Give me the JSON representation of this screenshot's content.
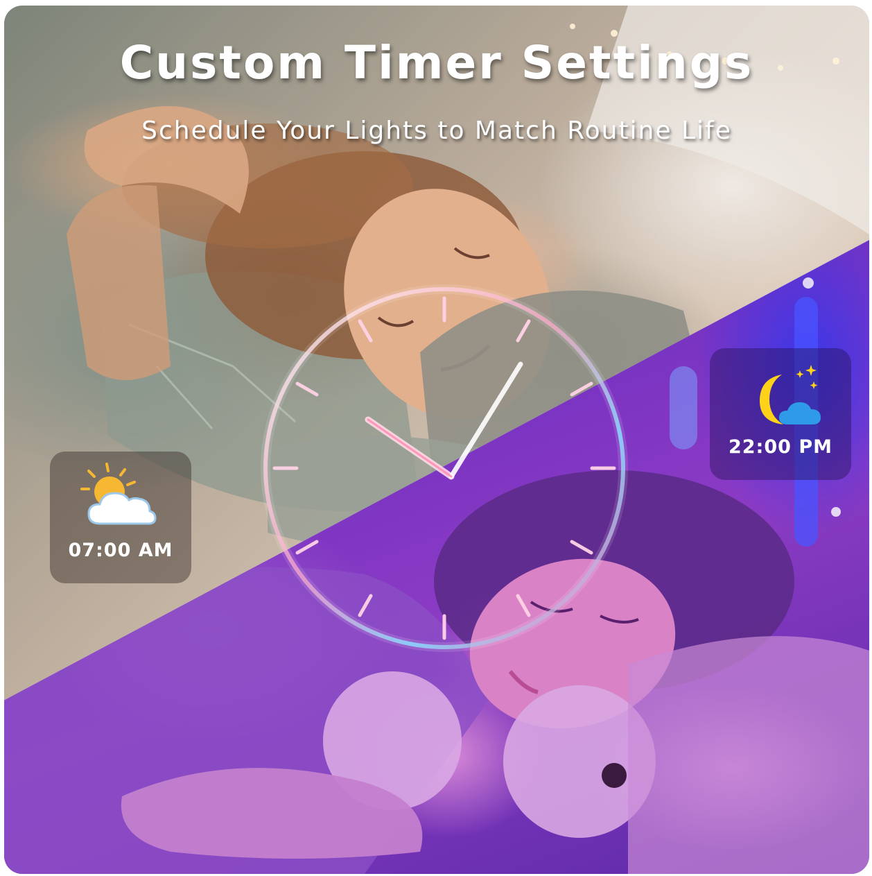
{
  "header": {
    "title": "Custom Timer Settings",
    "subtitle": "Schedule Your Lights to Match Routine Life"
  },
  "schedule": {
    "wake": {
      "time": "07:00 AM",
      "icon": "sun-behind-cloud-icon"
    },
    "sleep": {
      "time": "22:00 PM",
      "icon": "moon-and-cloud-icon"
    }
  },
  "clock": {
    "icon": "clock-face-icon"
  },
  "colors": {
    "day_tone": "#c9b19b",
    "night_tone": "#6a2dc0",
    "clock_glow": "#7ad8ff",
    "clock_pink": "#ff7fb0",
    "sun": "#f6b733",
    "moon": "#ffd21a",
    "night_cloud": "#2f9be8"
  },
  "scenes": {
    "day": "child-sleeping-daylight-photo",
    "night": "child-sleeping-night-light-photo"
  }
}
